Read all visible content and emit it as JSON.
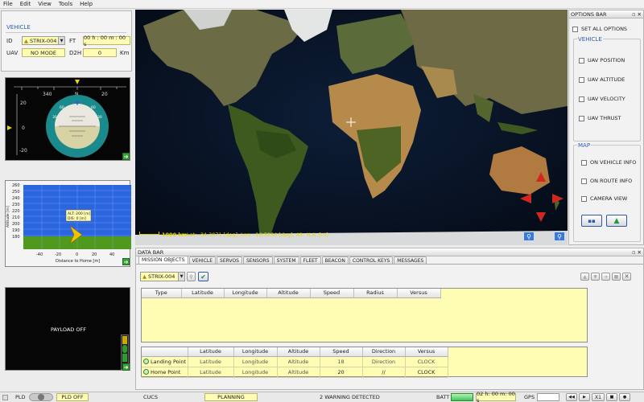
{
  "menu": [
    "File",
    "Edit",
    "View",
    "Tools",
    "Help"
  ],
  "vehicle_panel": {
    "title": "VEHICLE",
    "id_label": "ID",
    "id_value": "STRIX-004",
    "ft_label": "FT",
    "ft_value": "00 h : 00 m : 00 s",
    "uav_label": "UAV",
    "mode_value": "NO MODE",
    "d2h_label": "D2H",
    "d2h_value": "0",
    "d2h_unit": "Km"
  },
  "attitude_indicator": {
    "heading_ticks": [
      "340",
      "N",
      "20"
    ],
    "pitch_ticks": [
      "20",
      "0",
      "-20"
    ]
  },
  "altitude_profile": {
    "y_ticks": [
      "260",
      "250",
      "240",
      "230",
      "220",
      "210",
      "200",
      "190",
      "180"
    ],
    "x_ticks": [
      "-40",
      "-20",
      "0",
      "20",
      "40"
    ],
    "ylabel": "Altitude [m]",
    "xlabel": "Distance to Home [m]",
    "alt_readout": "ALT: 200 [m]",
    "dis_readout": "DIS: 0 [m]"
  },
  "payload": {
    "status": "PAYLOAD OFF"
  },
  "map": {
    "scale_label": "1000 km",
    "coords": "Lat: -34.3071 [deg], Lon: -16.5234 [deg], Alt: N.A. [m]"
  },
  "options_bar": {
    "title": "OPTIONS BAR",
    "set_all": "SET ALL OPTIONS",
    "vehicle_group": "VEHICLE",
    "vehicle_options": [
      "UAV POSITION",
      "UAV ALTITUDE",
      "UAV VELOCITY",
      "UAV THRUST"
    ],
    "map_group": "MAP",
    "map_options": [
      "ON VEHICLE INFO",
      "ON ROUTE INFO",
      "CAMERA VIEW"
    ]
  },
  "data_bar": {
    "title": "DATA BAR",
    "tabs": [
      "MISSION OBJECTS",
      "VEHICLE",
      "SERVOS",
      "SENSORS",
      "SYSTEM",
      "FLEET",
      "BEACON",
      "CONTROL KEYS",
      "MESSAGES"
    ],
    "vehicle_select": "STRIX-004",
    "objects_columns": [
      "Type",
      "Latitude",
      "Longitude",
      "Altitude",
      "Speed",
      "Radius",
      "Versus"
    ],
    "points_columns": [
      "",
      "Latitude",
      "Longitude",
      "Altitude",
      "Speed",
      "Direction",
      "Versus"
    ],
    "points_rows": [
      [
        "Landing Point",
        "Latitude",
        "Longitude",
        "Altitude",
        "18",
        "Direction",
        "CLOCK"
      ],
      [
        "Home Point",
        "Latitude",
        "Longitude",
        "Altitude",
        "20",
        "//",
        "CLOCK"
      ]
    ]
  },
  "status_bar": {
    "pld_label": "PLD",
    "pld_status": "PLD OFF",
    "cucs": "CUCS",
    "phase": "PLANNING",
    "warnings": "2 WARNING DETECTED",
    "batt_label": "BATT",
    "timer": "02 h: 00 m: 00 s",
    "gps_label": "GPS",
    "speed_mult": "X1"
  },
  "colors": {
    "yellow_field": "#fffcb4",
    "sky": "#2b66e0",
    "ground": "#4f9a1c",
    "accent_blue": "#2d5db8"
  }
}
